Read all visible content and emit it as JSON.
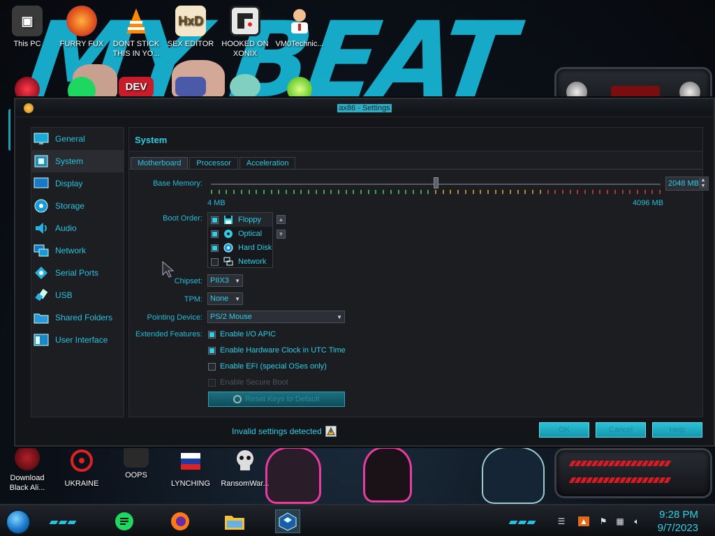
{
  "window": {
    "title": "ax86 - Settings"
  },
  "desktop_icons_top": [
    {
      "label": "This PC"
    },
    {
      "label": "FURRY FUX"
    },
    {
      "label": "DONT STICK THIS IN YO..."
    },
    {
      "label": "SEX EDITOR"
    },
    {
      "label": "HOOKED ON XONIX"
    },
    {
      "label": "VM0Technic..."
    }
  ],
  "desktop_icons_row2": [
    {
      "label": "DEV"
    }
  ],
  "desktop_icons_bottom": [
    {
      "label": "Download Black Ali..."
    },
    {
      "label": "UKRAINE"
    },
    {
      "label": "OOPS"
    },
    {
      "label": "LYNCHING"
    },
    {
      "label": "RansomWar..."
    }
  ],
  "sidebar": {
    "items": [
      {
        "label": "General",
        "icon": "monitor-icon"
      },
      {
        "label": "System",
        "icon": "chip-icon",
        "active": true
      },
      {
        "label": "Display",
        "icon": "display-icon"
      },
      {
        "label": "Storage",
        "icon": "disk-icon"
      },
      {
        "label": "Audio",
        "icon": "speaker-icon"
      },
      {
        "label": "Network",
        "icon": "network-icon"
      },
      {
        "label": "Serial Ports",
        "icon": "serial-icon"
      },
      {
        "label": "USB",
        "icon": "usb-icon"
      },
      {
        "label": "Shared Folders",
        "icon": "folder-icon"
      },
      {
        "label": "User Interface",
        "icon": "ui-icon"
      }
    ]
  },
  "content": {
    "header": "System",
    "tabs": [
      {
        "label": "Motherboard",
        "active": true
      },
      {
        "label": "Processor"
      },
      {
        "label": "Acceleration"
      }
    ],
    "motherboard": {
      "base_memory_label": "Base Memory:",
      "base_memory_value": "2048 MB",
      "base_memory_mb": 2048,
      "memory_min_label": "4 MB",
      "memory_max_label": "4096 MB",
      "boot_order_label": "Boot Order:",
      "boot_items": [
        {
          "label": "Floppy",
          "checked": true,
          "icon": "floppy-icon"
        },
        {
          "label": "Optical",
          "checked": true,
          "icon": "optical-icon"
        },
        {
          "label": "Hard Disk",
          "checked": true,
          "icon": "harddisk-icon"
        },
        {
          "label": "Network",
          "checked": false,
          "icon": "network-icon"
        }
      ],
      "chipset_label": "Chipset:",
      "chipset_value": "PIIX3",
      "tpm_label": "TPM:",
      "tpm_value": "None",
      "pointing_label": "Pointing Device:",
      "pointing_value": "PS/2 Mouse",
      "extended_label": "Extended Features:",
      "features": [
        {
          "label": "Enable I/O APIC",
          "checked": true,
          "disabled": false
        },
        {
          "label": "Enable Hardware Clock in UTC Time",
          "checked": true,
          "disabled": false
        },
        {
          "label": "Enable EFI (special OSes only)",
          "checked": false,
          "disabled": false
        },
        {
          "label": "Enable Secure Boot",
          "checked": false,
          "disabled": true
        }
      ],
      "reset_keys_label": "Reset Keys to Default"
    }
  },
  "footer": {
    "message": "Invalid settings detected",
    "ok": "OK",
    "cancel": "Cancel",
    "help": "Help"
  },
  "taskbar": {
    "time": "9:28 PM",
    "date": "9/7/2023"
  },
  "colors": {
    "accent": "#2fcde6",
    "window_bg": "#131518",
    "wallpaper_text": "#18b8d8"
  }
}
